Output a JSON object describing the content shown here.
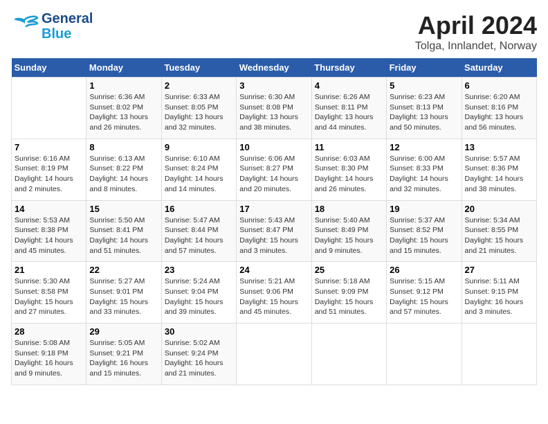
{
  "header": {
    "logo_line1": "General",
    "logo_line2": "Blue",
    "month_title": "April 2024",
    "location": "Tolga, Innlandet, Norway"
  },
  "columns": [
    "Sunday",
    "Monday",
    "Tuesday",
    "Wednesday",
    "Thursday",
    "Friday",
    "Saturday"
  ],
  "weeks": [
    [
      {
        "day": "",
        "info": ""
      },
      {
        "day": "1",
        "info": "Sunrise: 6:36 AM\nSunset: 8:02 PM\nDaylight: 13 hours\nand 26 minutes."
      },
      {
        "day": "2",
        "info": "Sunrise: 6:33 AM\nSunset: 8:05 PM\nDaylight: 13 hours\nand 32 minutes."
      },
      {
        "day": "3",
        "info": "Sunrise: 6:30 AM\nSunset: 8:08 PM\nDaylight: 13 hours\nand 38 minutes."
      },
      {
        "day": "4",
        "info": "Sunrise: 6:26 AM\nSunset: 8:11 PM\nDaylight: 13 hours\nand 44 minutes."
      },
      {
        "day": "5",
        "info": "Sunrise: 6:23 AM\nSunset: 8:13 PM\nDaylight: 13 hours\nand 50 minutes."
      },
      {
        "day": "6",
        "info": "Sunrise: 6:20 AM\nSunset: 8:16 PM\nDaylight: 13 hours\nand 56 minutes."
      }
    ],
    [
      {
        "day": "7",
        "info": "Sunrise: 6:16 AM\nSunset: 8:19 PM\nDaylight: 14 hours\nand 2 minutes."
      },
      {
        "day": "8",
        "info": "Sunrise: 6:13 AM\nSunset: 8:22 PM\nDaylight: 14 hours\nand 8 minutes."
      },
      {
        "day": "9",
        "info": "Sunrise: 6:10 AM\nSunset: 8:24 PM\nDaylight: 14 hours\nand 14 minutes."
      },
      {
        "day": "10",
        "info": "Sunrise: 6:06 AM\nSunset: 8:27 PM\nDaylight: 14 hours\nand 20 minutes."
      },
      {
        "day": "11",
        "info": "Sunrise: 6:03 AM\nSunset: 8:30 PM\nDaylight: 14 hours\nand 26 minutes."
      },
      {
        "day": "12",
        "info": "Sunrise: 6:00 AM\nSunset: 8:33 PM\nDaylight: 14 hours\nand 32 minutes."
      },
      {
        "day": "13",
        "info": "Sunrise: 5:57 AM\nSunset: 8:36 PM\nDaylight: 14 hours\nand 38 minutes."
      }
    ],
    [
      {
        "day": "14",
        "info": "Sunrise: 5:53 AM\nSunset: 8:38 PM\nDaylight: 14 hours\nand 45 minutes."
      },
      {
        "day": "15",
        "info": "Sunrise: 5:50 AM\nSunset: 8:41 PM\nDaylight: 14 hours\nand 51 minutes."
      },
      {
        "day": "16",
        "info": "Sunrise: 5:47 AM\nSunset: 8:44 PM\nDaylight: 14 hours\nand 57 minutes."
      },
      {
        "day": "17",
        "info": "Sunrise: 5:43 AM\nSunset: 8:47 PM\nDaylight: 15 hours\nand 3 minutes."
      },
      {
        "day": "18",
        "info": "Sunrise: 5:40 AM\nSunset: 8:49 PM\nDaylight: 15 hours\nand 9 minutes."
      },
      {
        "day": "19",
        "info": "Sunrise: 5:37 AM\nSunset: 8:52 PM\nDaylight: 15 hours\nand 15 minutes."
      },
      {
        "day": "20",
        "info": "Sunrise: 5:34 AM\nSunset: 8:55 PM\nDaylight: 15 hours\nand 21 minutes."
      }
    ],
    [
      {
        "day": "21",
        "info": "Sunrise: 5:30 AM\nSunset: 8:58 PM\nDaylight: 15 hours\nand 27 minutes."
      },
      {
        "day": "22",
        "info": "Sunrise: 5:27 AM\nSunset: 9:01 PM\nDaylight: 15 hours\nand 33 minutes."
      },
      {
        "day": "23",
        "info": "Sunrise: 5:24 AM\nSunset: 9:04 PM\nDaylight: 15 hours\nand 39 minutes."
      },
      {
        "day": "24",
        "info": "Sunrise: 5:21 AM\nSunset: 9:06 PM\nDaylight: 15 hours\nand 45 minutes."
      },
      {
        "day": "25",
        "info": "Sunrise: 5:18 AM\nSunset: 9:09 PM\nDaylight: 15 hours\nand 51 minutes."
      },
      {
        "day": "26",
        "info": "Sunrise: 5:15 AM\nSunset: 9:12 PM\nDaylight: 15 hours\nand 57 minutes."
      },
      {
        "day": "27",
        "info": "Sunrise: 5:11 AM\nSunset: 9:15 PM\nDaylight: 16 hours\nand 3 minutes."
      }
    ],
    [
      {
        "day": "28",
        "info": "Sunrise: 5:08 AM\nSunset: 9:18 PM\nDaylight: 16 hours\nand 9 minutes."
      },
      {
        "day": "29",
        "info": "Sunrise: 5:05 AM\nSunset: 9:21 PM\nDaylight: 16 hours\nand 15 minutes."
      },
      {
        "day": "30",
        "info": "Sunrise: 5:02 AM\nSunset: 9:24 PM\nDaylight: 16 hours\nand 21 minutes."
      },
      {
        "day": "",
        "info": ""
      },
      {
        "day": "",
        "info": ""
      },
      {
        "day": "",
        "info": ""
      },
      {
        "day": "",
        "info": ""
      }
    ]
  ]
}
